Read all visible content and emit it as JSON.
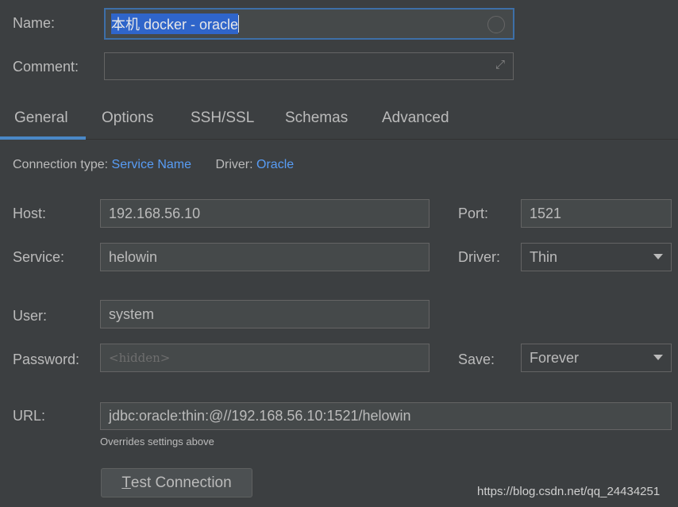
{
  "name": {
    "label": "Name:",
    "value": "本机 docker - oracle"
  },
  "comment": {
    "label": "Comment:",
    "value": ""
  },
  "tabs": [
    {
      "label": "General",
      "active": true
    },
    {
      "label": "Options"
    },
    {
      "label": "SSH/SSL"
    },
    {
      "label": "Schemas"
    },
    {
      "label": "Advanced"
    }
  ],
  "info": {
    "connection_type_label": "Connection type:",
    "connection_type": "Service Name",
    "driver_label": "Driver:",
    "driver": "Oracle"
  },
  "host": {
    "label": "Host:",
    "value": "192.168.56.10"
  },
  "port": {
    "label": "Port:",
    "value": "1521"
  },
  "service": {
    "label": "Service:",
    "value": "helowin"
  },
  "driver": {
    "label": "Driver:",
    "value": "Thin"
  },
  "user": {
    "label": "User:",
    "value": "system"
  },
  "password": {
    "label": "Password:",
    "placeholder": "<hidden>"
  },
  "save": {
    "label": "Save:",
    "value": "Forever"
  },
  "url": {
    "label": "URL:",
    "value": "jdbc:oracle:thin:@//192.168.56.10:1521/helowin",
    "hint": "Overrides settings above"
  },
  "test_button": {
    "mnemonic": "T",
    "rest": "est Connection"
  },
  "watermark": "https://blog.csdn.net/qq_24434251",
  "colors": {
    "background": "#3c3f41",
    "accent": "#4a88c7",
    "link": "#589df6",
    "selection": "#2f65ca"
  }
}
